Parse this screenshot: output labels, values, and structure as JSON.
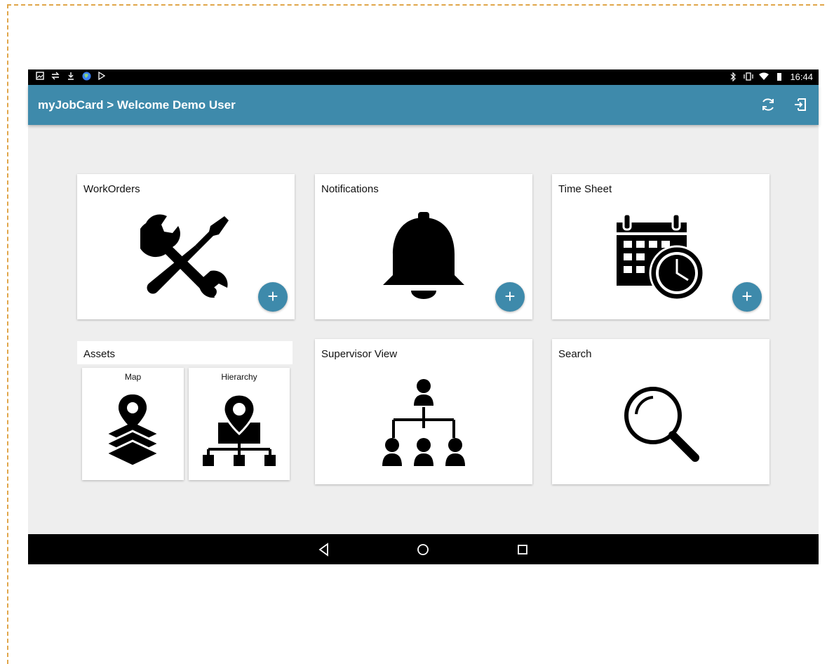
{
  "statusbar": {
    "time": "16:44"
  },
  "appbar": {
    "title": "myJobCard > Welcome Demo User",
    "sync_icon": "sync-icon",
    "logout_icon": "logout-icon"
  },
  "tiles": {
    "workorders": {
      "label": "WorkOrders",
      "icon": "wrench-screwdriver-icon",
      "action": "+"
    },
    "notifications": {
      "label": "Notifications",
      "icon": "bell-icon",
      "action": "+"
    },
    "timesheet": {
      "label": "Time Sheet",
      "icon": "calendar-clock-icon",
      "action": "+"
    },
    "assets": {
      "label": "Assets",
      "map": {
        "label": "Map",
        "icon": "map-layers-icon"
      },
      "hierarchy": {
        "label": "Hierarchy",
        "icon": "location-hierarchy-icon"
      }
    },
    "supervisor": {
      "label": "Supervisor View",
      "icon": "org-chart-icon"
    },
    "search": {
      "label": "Search",
      "icon": "magnifier-icon"
    }
  },
  "colors": {
    "accent": "#3e8aab",
    "background": "#eeeeee"
  }
}
